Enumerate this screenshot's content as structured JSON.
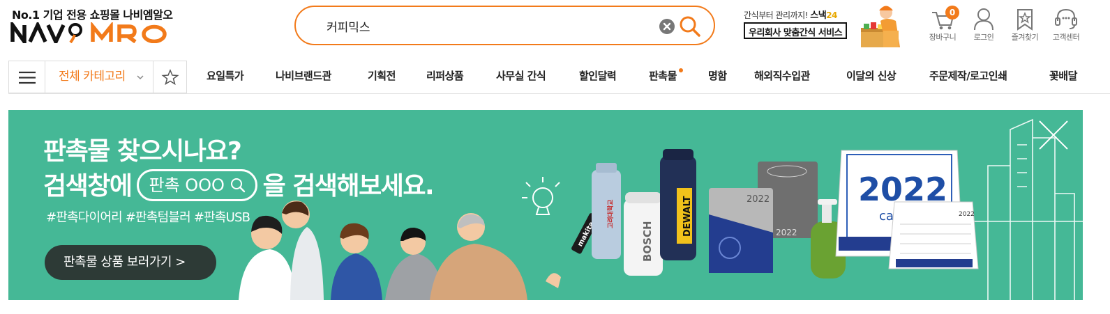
{
  "header": {
    "tagline": "No.1 기업 전용 쇼핑몰 나비엠알오",
    "logo_text": "NAVI MRO",
    "search": {
      "value": "커피믹스",
      "placeholder": ""
    },
    "ad": {
      "line1_prefix": "간식부터 관리까지!",
      "line1_brand": "스낵",
      "line1_num": "24",
      "line2": "우리회사 맞춤간식 서비스"
    },
    "utilities": [
      {
        "label": "장바구니",
        "icon": "cart-icon",
        "count": "0"
      },
      {
        "label": "로그인",
        "icon": "user-icon"
      },
      {
        "label": "즐겨찾기",
        "icon": "bookmark-star-icon"
      },
      {
        "label": "고객센터",
        "icon": "headset-icon"
      }
    ]
  },
  "nav": {
    "all_categories": "전체 카테고리",
    "items": [
      "요일특가",
      "나비브랜드관",
      "기획전",
      "리퍼상품",
      "사무실 간식",
      "할인달력",
      "판촉물",
      "명함",
      "해외직수입관",
      "이달의 신상",
      "주문제작/로고인쇄",
      "꽃배달"
    ]
  },
  "banner": {
    "headline1": "판촉물 찾으시나요?",
    "headline2_pre": "검색창에",
    "search_pill": "판촉 OOO",
    "headline2_post": "을 검색해보세요.",
    "hashtags": "#판촉다이어리 #판촉텀블러 #판촉USB",
    "cta": "판촉물 상품 보러가기  >",
    "product_texts": {
      "usb": "makita",
      "bottle1": "고려대학교",
      "bottle2": "BOSCH",
      "bottle3": "DEWALT",
      "diary_top": "2022",
      "diary_bottom": "2022",
      "calendar_year": "2022",
      "calendar_word": "caler",
      "calendar_small_year": "2022"
    },
    "colors": {
      "background": "#45b896",
      "cta": "#2d3a36"
    }
  },
  "colors": {
    "accent": "#f27a1a"
  }
}
